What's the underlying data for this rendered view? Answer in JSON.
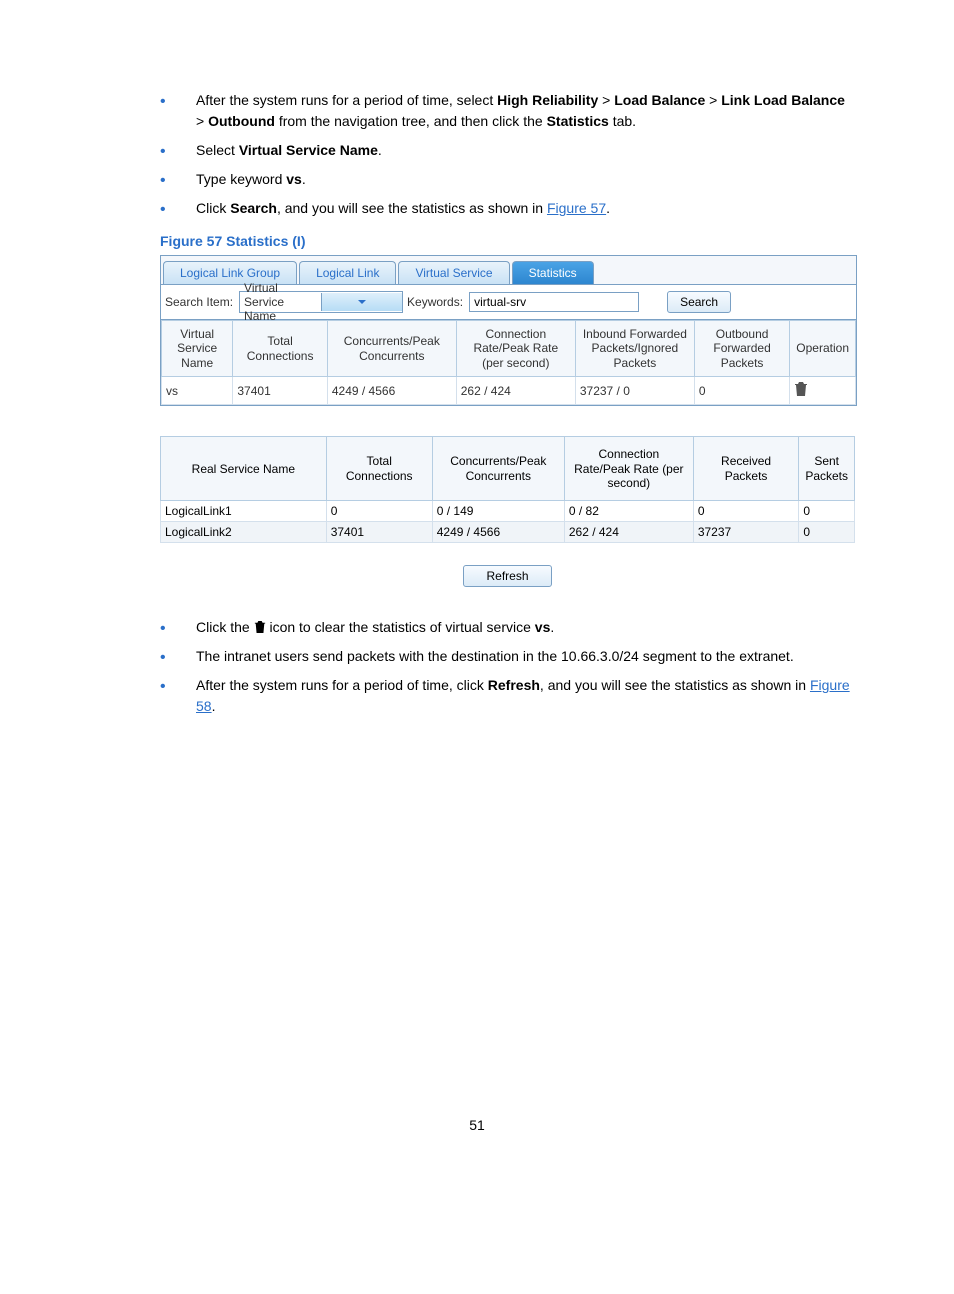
{
  "bullets_top": [
    {
      "pre": "After the system runs for a period of time, select ",
      "b1": "High Reliability",
      "sep": " > ",
      "b2": "Load Balance",
      "b3": "Link Load Balance",
      "b4": "Outbound",
      "mid": " from the navigation tree, and then click the ",
      "b5": "Statistics",
      "post": " tab."
    },
    {
      "pre": "Select ",
      "b1": "Virtual Service Name",
      "post": "."
    },
    {
      "pre": "Type keyword ",
      "b1": "vs",
      "post": "."
    },
    {
      "pre": "Click ",
      "b1": "Search",
      "mid": ", and you will see the statistics as shown in ",
      "link": "Figure 57",
      "post": "."
    }
  ],
  "figure_caption": "Figure 57 Statistics (I)",
  "tabs": {
    "llg": "Logical Link Group",
    "ll": "Logical Link",
    "vs": "Virtual Service",
    "stat": "Statistics"
  },
  "search": {
    "item_label": "Search Item:",
    "item_value": "Virtual Service Name",
    "kw_label": "Keywords:",
    "kw_value": "virtual-srv",
    "button": "Search"
  },
  "table1": {
    "headers": {
      "c0": "Virtual Service Name",
      "c1": "Total Connections",
      "c2": "Concurrents/Peak Concurrents",
      "c3": "Connection Rate/Peak Rate (per second)",
      "c4": "Inbound Forwarded Packets/Ignored Packets",
      "c5": "Outbound Forwarded Packets",
      "c6": "Operation"
    },
    "row": {
      "c0": "vs",
      "c1": "37401",
      "c2": "4249 / 4566",
      "c3": "262 / 424",
      "c4": "37237 / 0",
      "c5": "0"
    }
  },
  "table2": {
    "headers": {
      "c0": "Real Service Name",
      "c1": "Total Connections",
      "c2": "Concurrents/Peak Concurrents",
      "c3": "Connection Rate/Peak Rate (per second)",
      "c4": "Received Packets",
      "c5": "Sent Packets"
    },
    "rows": [
      {
        "c0": "LogicalLink1",
        "c1": "0",
        "c2": "0 / 149",
        "c3": "0 / 82",
        "c4": "0",
        "c5": "0"
      },
      {
        "c0": "LogicalLink2",
        "c1": "37401",
        "c2": "4249 / 4566",
        "c3": "262 / 424",
        "c4": "37237",
        "c5": "0"
      }
    ]
  },
  "refresh_label": "Refresh",
  "bullets_bottom": {
    "b0": {
      "pre": "Click the ",
      "post": " icon to clear the statistics of virtual service ",
      "bold": "vs",
      "end": "."
    },
    "b1": "The intranet users send packets with the destination in the 10.66.3.0/24 segment to the extranet.",
    "b2": {
      "pre": "After the system runs for a period of time, click ",
      "bold": "Refresh",
      "mid": ", and you will see the statistics as shown in ",
      "link": "Figure 58",
      "end": "."
    }
  },
  "page_number": "51"
}
